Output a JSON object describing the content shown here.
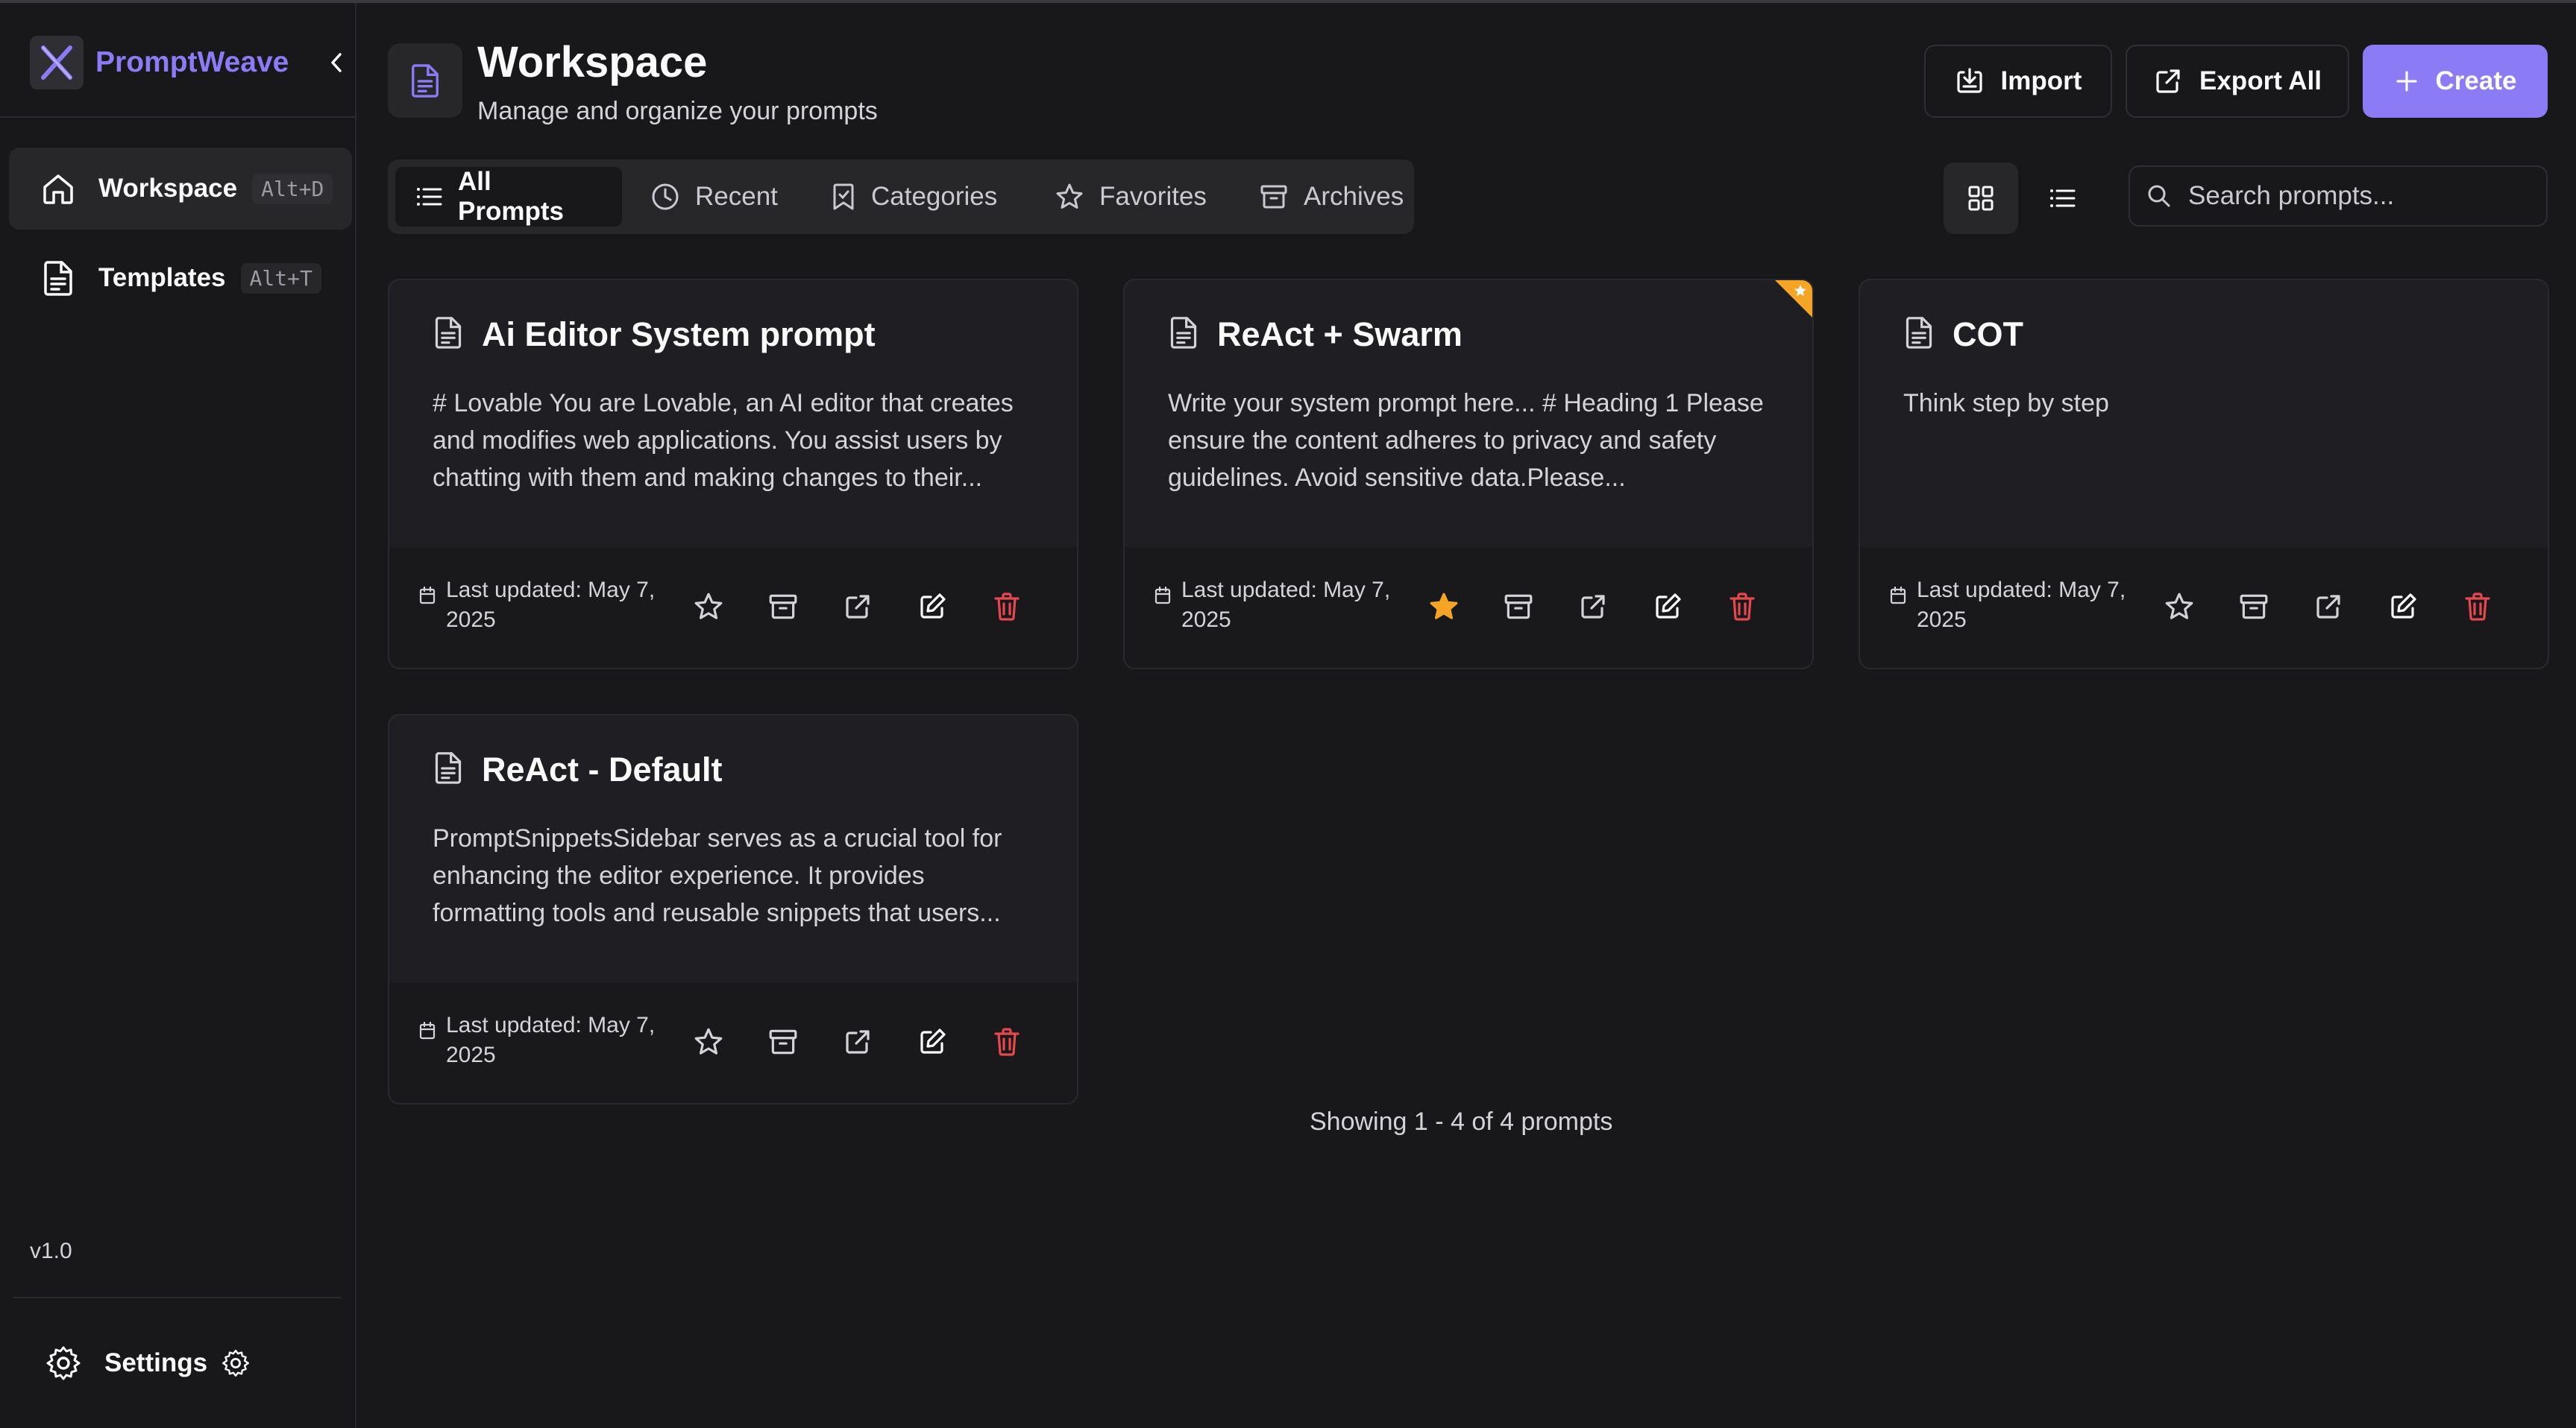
{
  "app": {
    "name": "PromptWeave",
    "version": "v1.0"
  },
  "sidebar": {
    "items": [
      {
        "label": "Workspace",
        "shortcut": "Alt+D",
        "icon": "home-icon"
      },
      {
        "label": "Templates",
        "shortcut": "Alt+T",
        "icon": "document-icon"
      }
    ],
    "settings_label": "Settings"
  },
  "header": {
    "title": "Workspace",
    "subtitle": "Manage and organize your prompts",
    "import_label": "Import",
    "export_label": "Export All",
    "create_label": "Create"
  },
  "tabs": [
    {
      "label": "All Prompts",
      "icon": "list-icon",
      "active": true
    },
    {
      "label": "Recent",
      "icon": "clock-icon"
    },
    {
      "label": "Categories",
      "icon": "bookmark-icon"
    },
    {
      "label": "Favorites",
      "icon": "star-icon"
    },
    {
      "label": "Archives",
      "icon": "archive-icon"
    }
  ],
  "search": {
    "placeholder": "Search prompts..."
  },
  "cards": [
    {
      "title": "Ai Editor System prompt",
      "body": "# Lovable You are Lovable, an AI editor that creates and modifies web applications. You assist users by chatting with them and making changes to their...",
      "date": "Last updated: May 7, 2025",
      "favorite": false
    },
    {
      "title": "ReAct + Swarm",
      "body": "Write your system prompt here... # Heading 1 Please ensure the content adheres to privacy and safety guidelines. Avoid sensitive data.Please...",
      "date": "Last updated: May 7, 2025",
      "favorite": true
    },
    {
      "title": "COT",
      "body": "Think step by step",
      "date": "Last updated: May 7, 2025",
      "favorite": false
    },
    {
      "title": "ReAct - Default",
      "body": "PromptSnippetsSidebar serves as a crucial tool for enhancing the editor experience. It provides formatting tools and reusable snippets that users...",
      "date": "Last updated: May 7, 2025",
      "favorite": false
    }
  ],
  "pagination": {
    "text": "Showing 1 - 4 of 4 prompts"
  },
  "colors": {
    "accent": "#8b7cf6",
    "favorite": "#f5a524",
    "danger": "#e5484d"
  }
}
